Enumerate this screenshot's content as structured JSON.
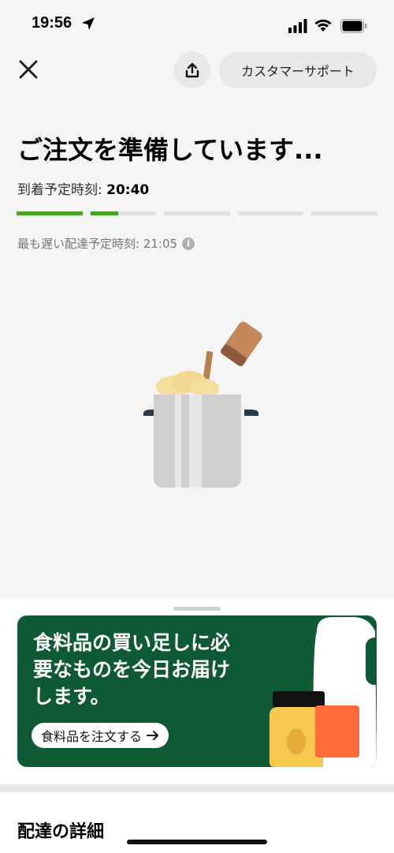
{
  "status_bar": {
    "time": "19:56"
  },
  "nav": {
    "support_label": "カスタマーサポート"
  },
  "order": {
    "title": "ご注文を準備しています...",
    "eta_label": "到着予定時刻:",
    "eta_time": "20:40",
    "latest_label": "最も遅い配達予定時刻: 21:05",
    "progress_fill": [
      1.0,
      0.42,
      0.0,
      0.0,
      0.0
    ]
  },
  "promo": {
    "text": "食料品の買い足しに必要なものを今日お届けします。",
    "button_label": "食料品を注文する"
  },
  "details": {
    "title": "配達の詳細"
  },
  "colors": {
    "accent_green": "#46a31f",
    "promo_bg": "#0e5a35"
  }
}
